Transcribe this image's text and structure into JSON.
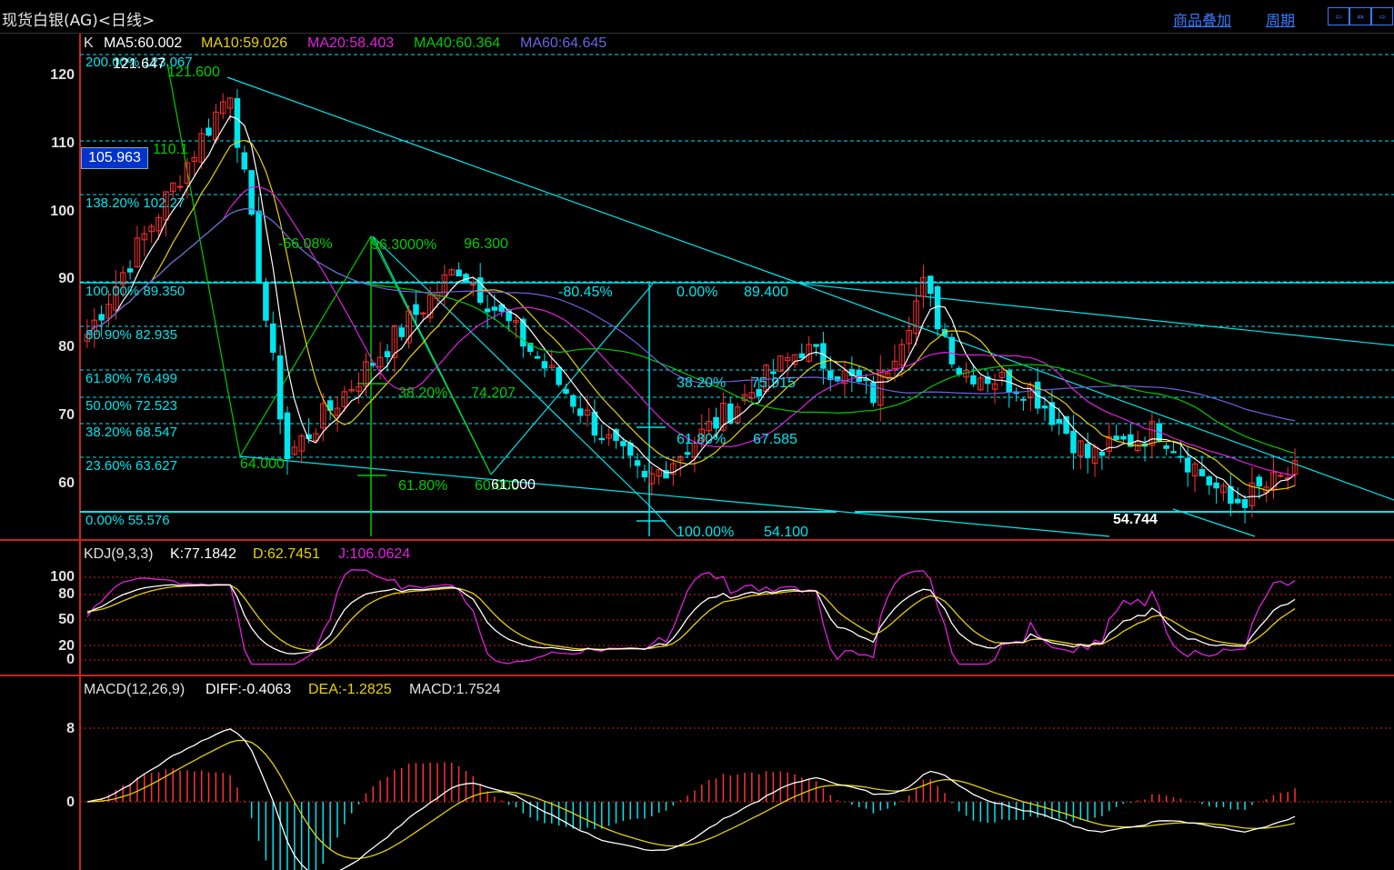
{
  "window": {
    "title": "现货白银(AG)<日线>",
    "links": [
      "商品叠加",
      "周期"
    ],
    "nav_icons": [
      "scroll-left-icon",
      "expand-icon",
      "scroll-right-icon"
    ]
  },
  "colors": {
    "background": "#000000",
    "up": "#ff3030",
    "down": "#00e5ee",
    "ma5": "#ffffff",
    "ma10": "#e6d200",
    "ma20": "#e020e0",
    "ma40": "#00cc00",
    "ma60": "#7060e0",
    "grid": "#cc2222",
    "fib": "#00e5ee"
  },
  "price_panel": {
    "label": "K",
    "ma_values": [
      {
        "name": "MA5",
        "text": "MA5:60.002"
      },
      {
        "name": "MA10",
        "text": "MA10:59.026"
      },
      {
        "name": "MA20",
        "text": "MA20:58.403"
      },
      {
        "name": "MA40",
        "text": "MA40:60.364"
      },
      {
        "name": "MA60",
        "text": "MA60:64.645"
      }
    ],
    "y_ticks": [
      "120",
      "110",
      "100",
      "90",
      "80",
      "70",
      "60"
    ],
    "current_price": "105.963",
    "fib_levels": [
      {
        "text": "200.00% 123.067"
      },
      {
        "text": "138.20% 102.27"
      },
      {
        "text": "100.00% 89.350"
      },
      {
        "text": "80.90% 82.935"
      },
      {
        "text": "61.80% 76.499"
      },
      {
        "text": "50.00% 72.523"
      },
      {
        "text": "38.20% 68.547"
      },
      {
        "text": "23.60% 63.627"
      },
      {
        "text": "0.00% 55.576"
      }
    ],
    "annotations": [
      {
        "text": "121.647",
        "color": "#ffffff"
      },
      {
        "text": "121.600",
        "color": "#00cc00"
      },
      {
        "text": "110.1",
        "color": "#00cc00"
      },
      {
        "text": "-56.08%",
        "color": "#00cc00"
      },
      {
        "text": "96.3000%",
        "color": "#00cc00"
      },
      {
        "text": "96.300",
        "color": "#00cc00"
      },
      {
        "text": "-80.45%",
        "color": "#00e5ee"
      },
      {
        "text": "0.00%",
        "color": "#00e5ee"
      },
      {
        "text": "89.400",
        "color": "#00e5ee"
      },
      {
        "text": "38.20%",
        "color": "#00cc00"
      },
      {
        "text": "74.207",
        "color": "#00cc00"
      },
      {
        "text": "38.20%",
        "color": "#00e5ee"
      },
      {
        "text": "75.915",
        "color": "#00e5ee"
      },
      {
        "text": "61.80%",
        "color": "#00e5ee"
      },
      {
        "text": "67.585",
        "color": "#00e5ee"
      },
      {
        "text": "64.000",
        "color": "#00cc00"
      },
      {
        "text": "61.80%",
        "color": "#00cc00"
      },
      {
        "text": "60.000",
        "color": "#00cc00"
      },
      {
        "text": "61.000",
        "color": "#ffffff"
      },
      {
        "text": "100.00%",
        "color": "#00e5ee"
      },
      {
        "text": "54.100",
        "color": "#00e5ee"
      },
      {
        "text": "54.744",
        "color": "#ffffff"
      }
    ]
  },
  "kdj_panel": {
    "label": "KDJ(9,3,3)",
    "k": "K:77.1842",
    "d": "D:62.7451",
    "j": "J:106.0624",
    "y_ticks": [
      "100",
      "80",
      "50",
      "20",
      "0"
    ]
  },
  "macd_panel": {
    "label": "MACD(12,26,9)",
    "diff": "DIFF:-0.4063",
    "dea": "DEA:-1.2825",
    "macd": "MACD:1.7524",
    "y_ticks": [
      "8",
      "0"
    ]
  }
}
